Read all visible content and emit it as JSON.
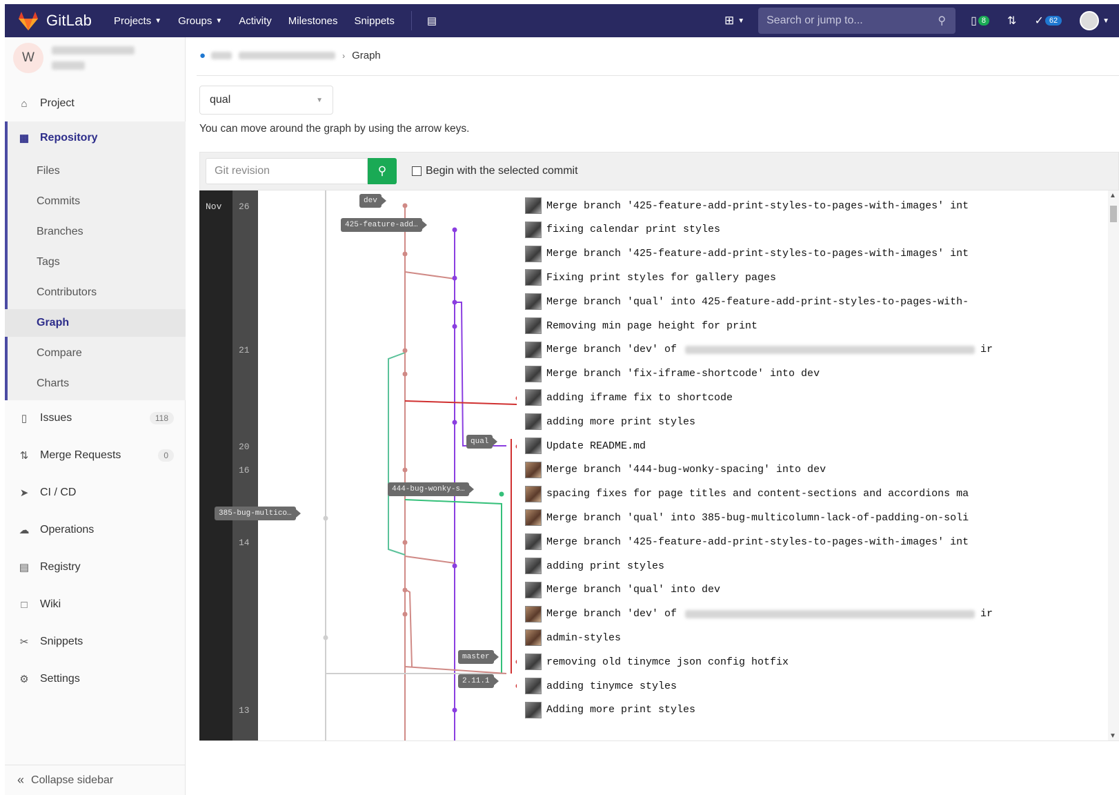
{
  "nav": {
    "brand": "GitLab",
    "links": [
      "Projects",
      "Groups",
      "Activity",
      "Milestones",
      "Snippets"
    ],
    "search_placeholder": "Search or jump to...",
    "issues_count": "8",
    "todos_count": "62"
  },
  "sidebar": {
    "avatar_letter": "W",
    "project": "Project",
    "repository": "Repository",
    "repo_items": [
      "Files",
      "Commits",
      "Branches",
      "Tags",
      "Contributors",
      "Graph",
      "Compare",
      "Charts"
    ],
    "issues": "Issues",
    "issues_count": "118",
    "merge_requests": "Merge Requests",
    "mr_count": "0",
    "cicd": "CI / CD",
    "operations": "Operations",
    "registry": "Registry",
    "wiki": "Wiki",
    "snippets": "Snippets",
    "settings": "Settings",
    "collapse": "Collapse sidebar"
  },
  "breadcrumb": {
    "current": "Graph"
  },
  "ref_select": "qual",
  "hint": "You can move around the graph by using the arrow keys.",
  "revision": {
    "placeholder": "Git revision",
    "checkbox_label": "Begin with the selected commit"
  },
  "graph": {
    "month": "Nov",
    "days": [
      "26",
      "21",
      "20",
      "16",
      "14",
      "13"
    ],
    "labels": [
      "dev",
      "425-feature-add…",
      "qual",
      "444-bug-wonky-s…",
      "385-bug-multico…",
      "master",
      "2.11.1"
    ],
    "commits": [
      {
        "msg": "Merge branch '425-feature-add-print-styles-to-pages-with-images' int",
        "trail": ""
      },
      {
        "msg": "fixing calendar print styles",
        "trail": ""
      },
      {
        "msg": "Merge branch '425-feature-add-print-styles-to-pages-with-images' int",
        "trail": ""
      },
      {
        "msg": "Fixing print styles for gallery pages",
        "trail": ""
      },
      {
        "msg": "Merge branch 'qual' into 425-feature-add-print-styles-to-pages-with-",
        "trail": ""
      },
      {
        "msg": "Removing min page height for print",
        "trail": ""
      },
      {
        "msg": "Merge branch 'dev' of",
        "trail": "ir"
      },
      {
        "msg": "Merge branch 'fix-iframe-shortcode' into dev",
        "trail": ""
      },
      {
        "msg": "adding iframe fix to shortcode",
        "trail": ""
      },
      {
        "msg": "adding more print styles",
        "trail": ""
      },
      {
        "msg": "Update README.md",
        "trail": ""
      },
      {
        "msg": "Merge branch '444-bug-wonky-spacing' into dev",
        "trail": ""
      },
      {
        "msg": "spacing fixes for page titles and content-sections and accordions ma",
        "trail": ""
      },
      {
        "msg": "Merge branch 'qual' into 385-bug-multicolumn-lack-of-padding-on-soli",
        "trail": ""
      },
      {
        "msg": "Merge branch '425-feature-add-print-styles-to-pages-with-images' int",
        "trail": ""
      },
      {
        "msg": "adding print styles",
        "trail": ""
      },
      {
        "msg": "Merge branch 'qual' into dev",
        "trail": ""
      },
      {
        "msg": "Merge branch 'dev' of",
        "trail": "ir"
      },
      {
        "msg": "admin-styles",
        "trail": ""
      },
      {
        "msg": "removing old tinymce json config hotfix",
        "trail": ""
      },
      {
        "msg": "adding tinymce styles",
        "trail": ""
      },
      {
        "msg": "Adding more print styles",
        "trail": ""
      }
    ]
  },
  "colors": {
    "nav_bg": "#292961",
    "accent": "#1aaa55",
    "active": "#4b4ba3"
  }
}
